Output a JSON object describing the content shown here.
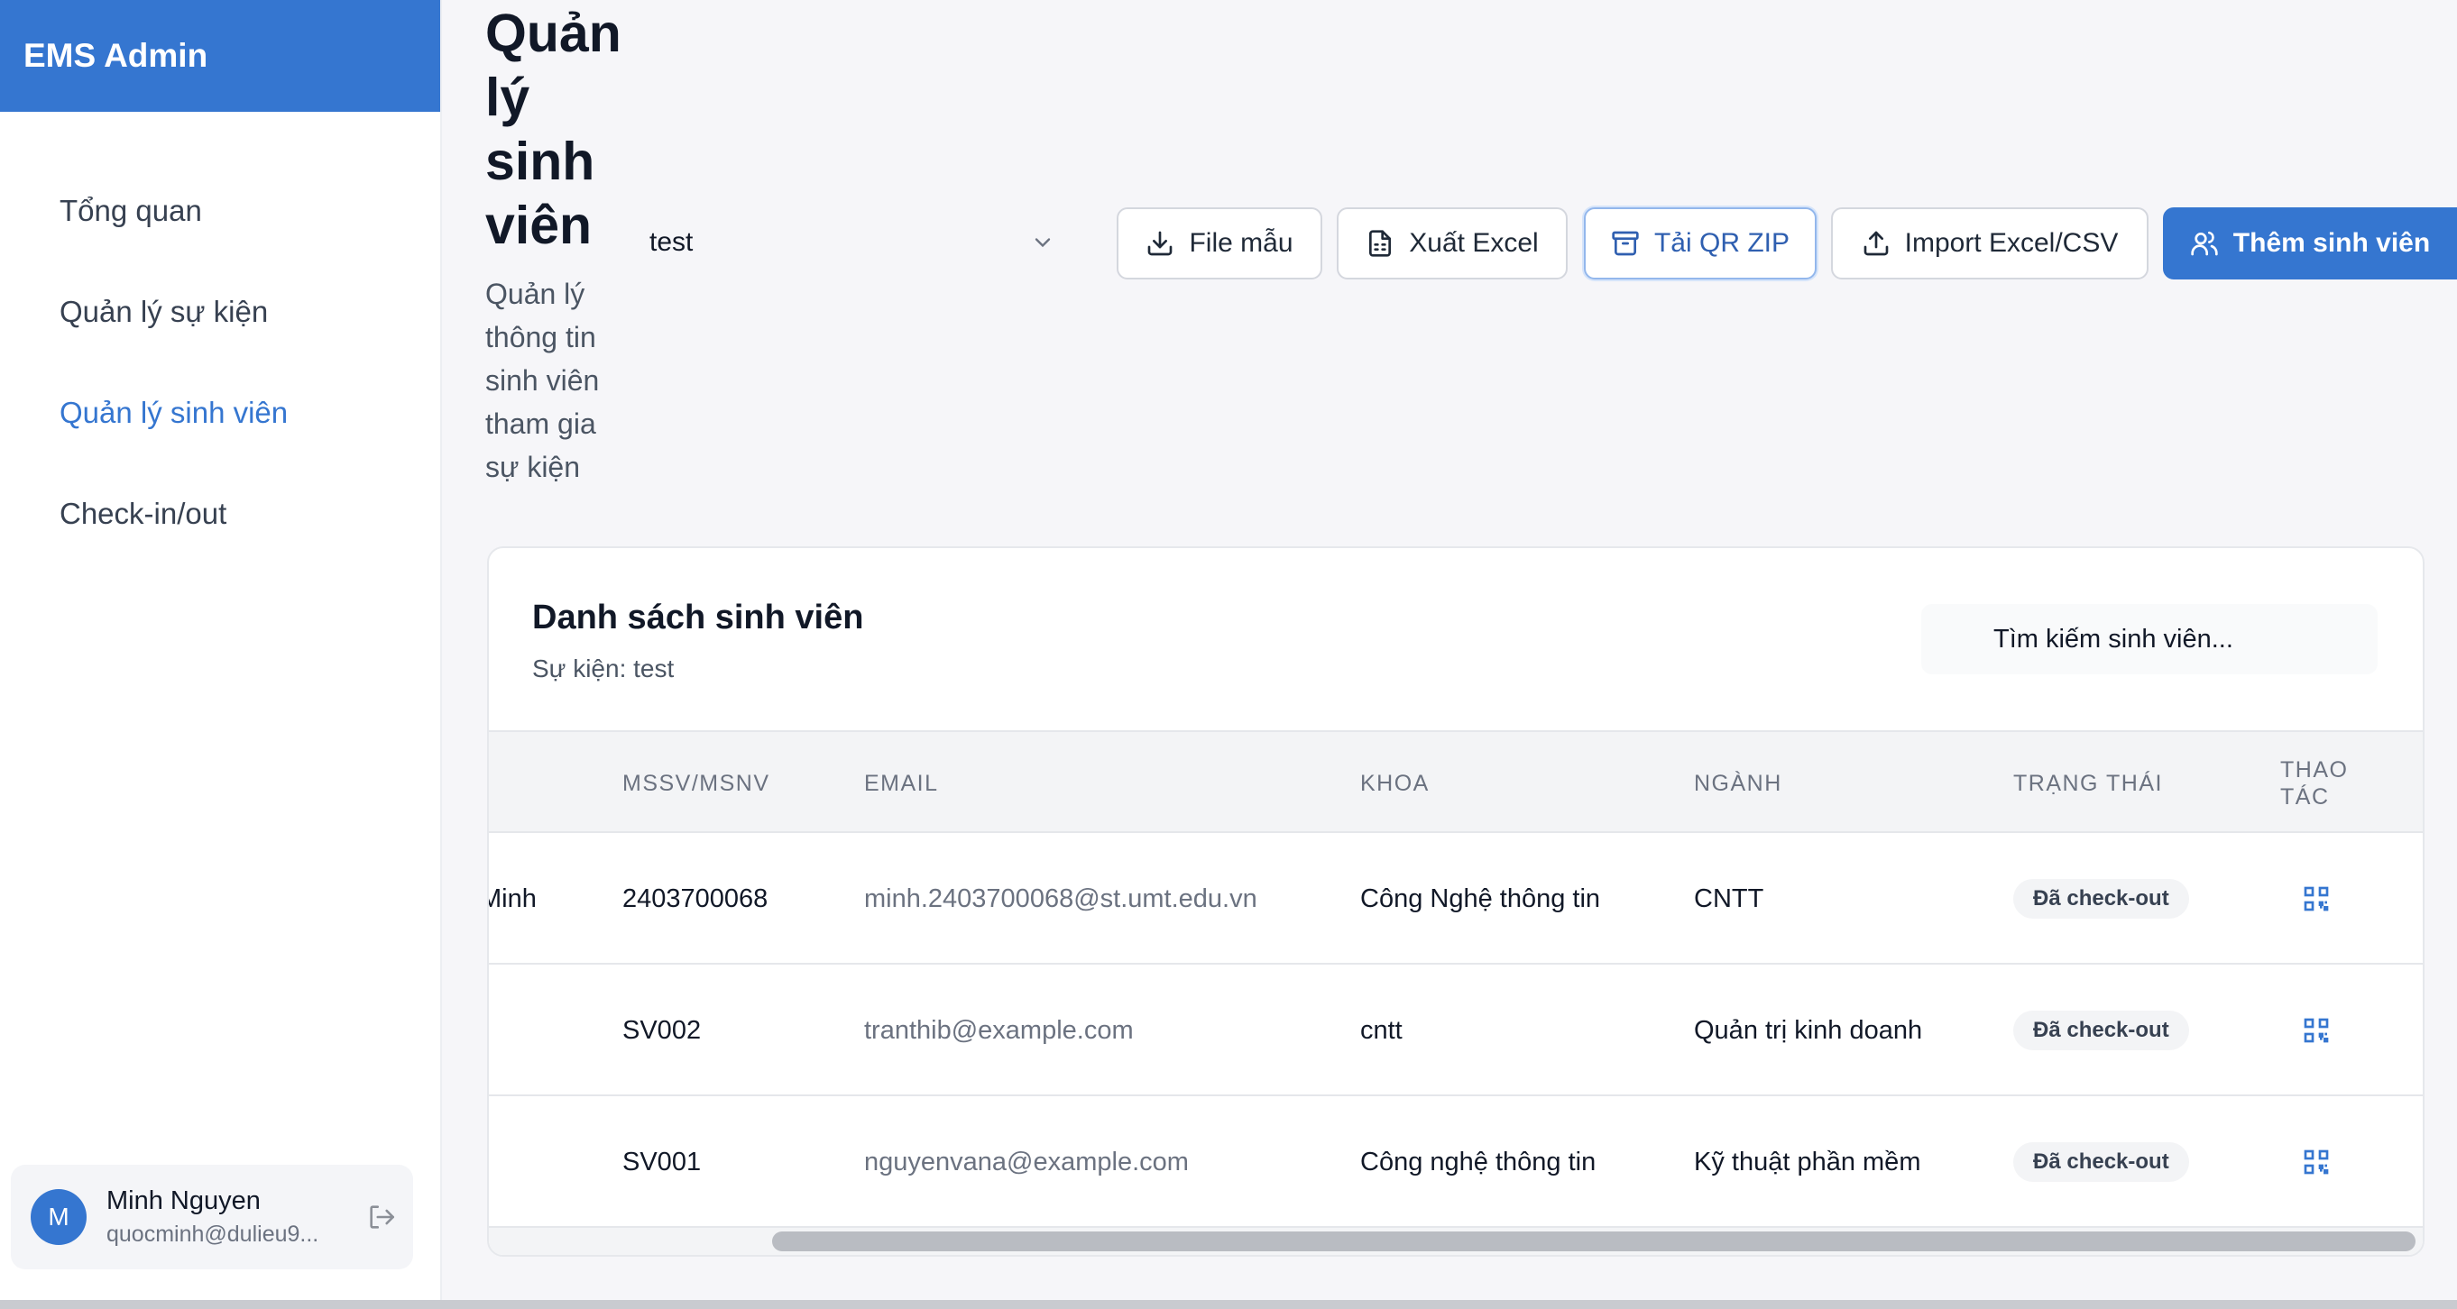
{
  "app": {
    "brand": "EMS Admin"
  },
  "sidebar": {
    "items": [
      {
        "label": "Tổng quan"
      },
      {
        "label": "Quản lý sự kiện"
      },
      {
        "label": "Quản lý sinh viên"
      },
      {
        "label": "Check-in/out"
      }
    ],
    "active_index": 2
  },
  "user": {
    "initial": "M",
    "name": "Minh Nguyen",
    "email": "quocminh@dulieu9..."
  },
  "header": {
    "title": "Quản lý sinh viên",
    "subtitle": "Quản lý thông tin sinh viên tham gia sự kiện",
    "event_select": "test"
  },
  "toolbar": {
    "template_label": "File mẫu",
    "export_label": "Xuất Excel",
    "qr_zip_label": "Tải QR ZIP",
    "import_label": "Import Excel/CSV",
    "add_label": "Thêm sinh viên"
  },
  "card": {
    "title": "Danh sách sinh viên",
    "subtitle": "Sự kiện: test",
    "search_placeholder": "Tìm kiếm sinh viên..."
  },
  "table": {
    "columns": [
      "MSSV/MSNV",
      "EMAIL",
      "KHOA",
      "NGÀNH",
      "TRẠNG THÁI",
      "THAO TÁC"
    ],
    "rows": [
      {
        "name": "Minh",
        "id": "2403700068",
        "email": "minh.2403700068@st.umt.edu.vn",
        "faculty": "Công Nghệ thông tin",
        "major": "CNTT",
        "status": "Đã check-out"
      },
      {
        "name": "",
        "id": "SV002",
        "email": "tranthib@example.com",
        "faculty": "cntt",
        "major": "Quản trị kinh doanh",
        "status": "Đã check-out"
      },
      {
        "name": "",
        "id": "SV001",
        "email": "nguyenvana@example.com",
        "faculty": "Công nghệ thông tin",
        "major": "Kỹ thuật phần mềm",
        "status": "Đã check-out"
      }
    ]
  },
  "colors": {
    "accent": "#3576d0",
    "background": "#f6f6f9"
  }
}
